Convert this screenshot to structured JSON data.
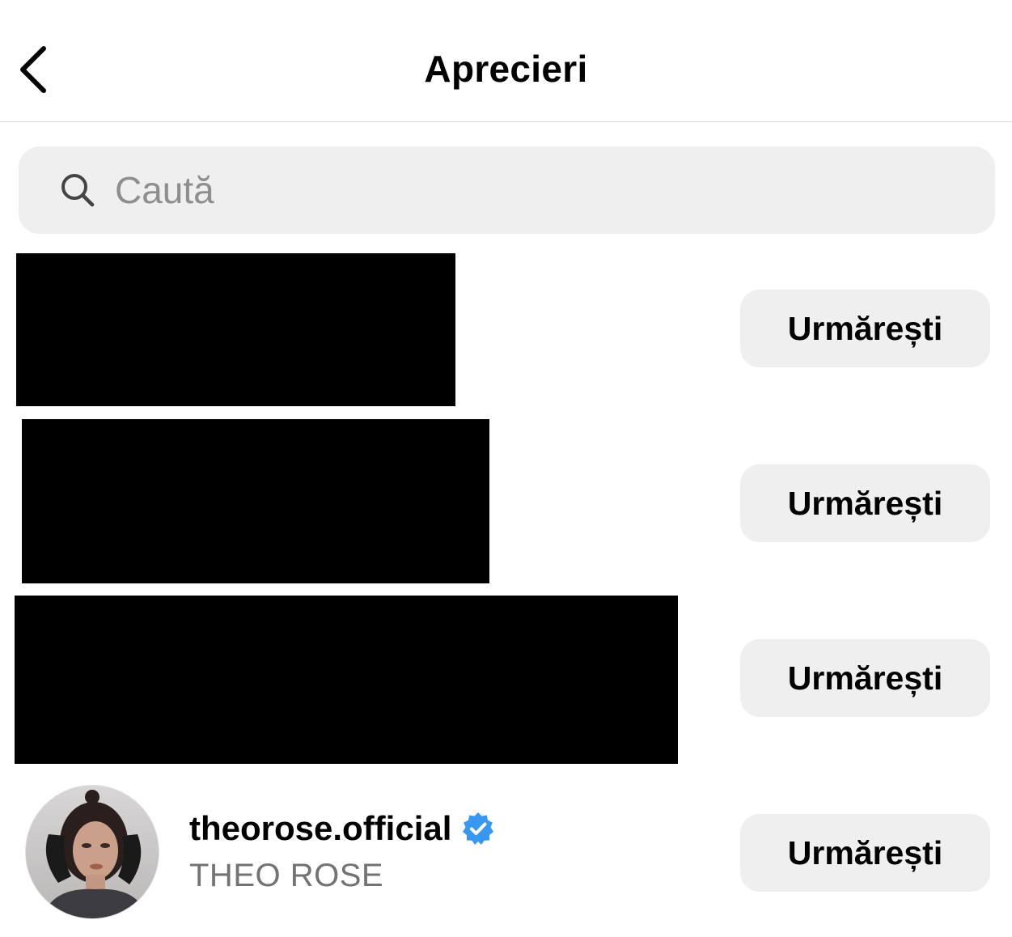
{
  "header": {
    "title": "Aprecieri",
    "back_icon": "chevron-left-icon"
  },
  "search": {
    "placeholder": "Caută",
    "value": "",
    "icon": "search-icon"
  },
  "likes": [
    {
      "redacted": true,
      "follow_label": "Urmărești"
    },
    {
      "redacted": true,
      "follow_label": "Urmărești"
    },
    {
      "redacted": true,
      "follow_label": "Urmărești"
    },
    {
      "redacted": false,
      "username": "theorose.official",
      "verified": true,
      "full_name": "THEO ROSE",
      "follow_label": "Urmărești"
    }
  ],
  "colors": {
    "verified_badge": "#3897f0",
    "button_bg": "#efefef",
    "secondary_text": "#737373"
  }
}
